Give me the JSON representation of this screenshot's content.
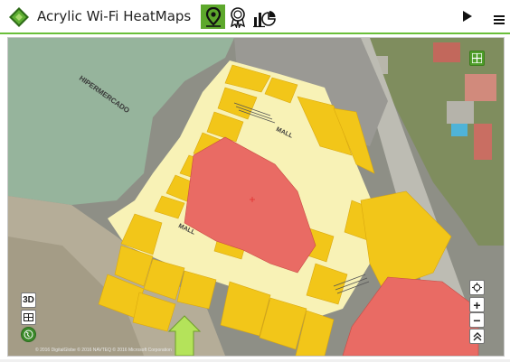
{
  "app": {
    "title": "Acrylic Wi-Fi HeatMaps"
  },
  "toolbar": {
    "tabs": [
      {
        "icon": "map-marker-icon",
        "active": true
      },
      {
        "icon": "award-ribbon-icon",
        "active": false
      },
      {
        "icon": "reports-chart-icon",
        "active": false
      }
    ],
    "play_icon": "play-icon",
    "menu_icon": "hamburger-menu-icon"
  },
  "map": {
    "labels": {
      "hypermarket": "HIPERMERCADO",
      "mall_top": "MALL",
      "mall_bottom": "MALL"
    },
    "controls": {
      "view_3d": "3D",
      "zoom_in": "+",
      "zoom_out": "−"
    },
    "attribution": "© 2016 DigitalGlobe © 2016 NAVTEQ © 2016 Microsoft Corporation"
  },
  "colors": {
    "accent": "#5da82c",
    "store_yellow": "#f2c619",
    "corridor": "#f8f2b6",
    "red_zone": "#e96b64"
  }
}
